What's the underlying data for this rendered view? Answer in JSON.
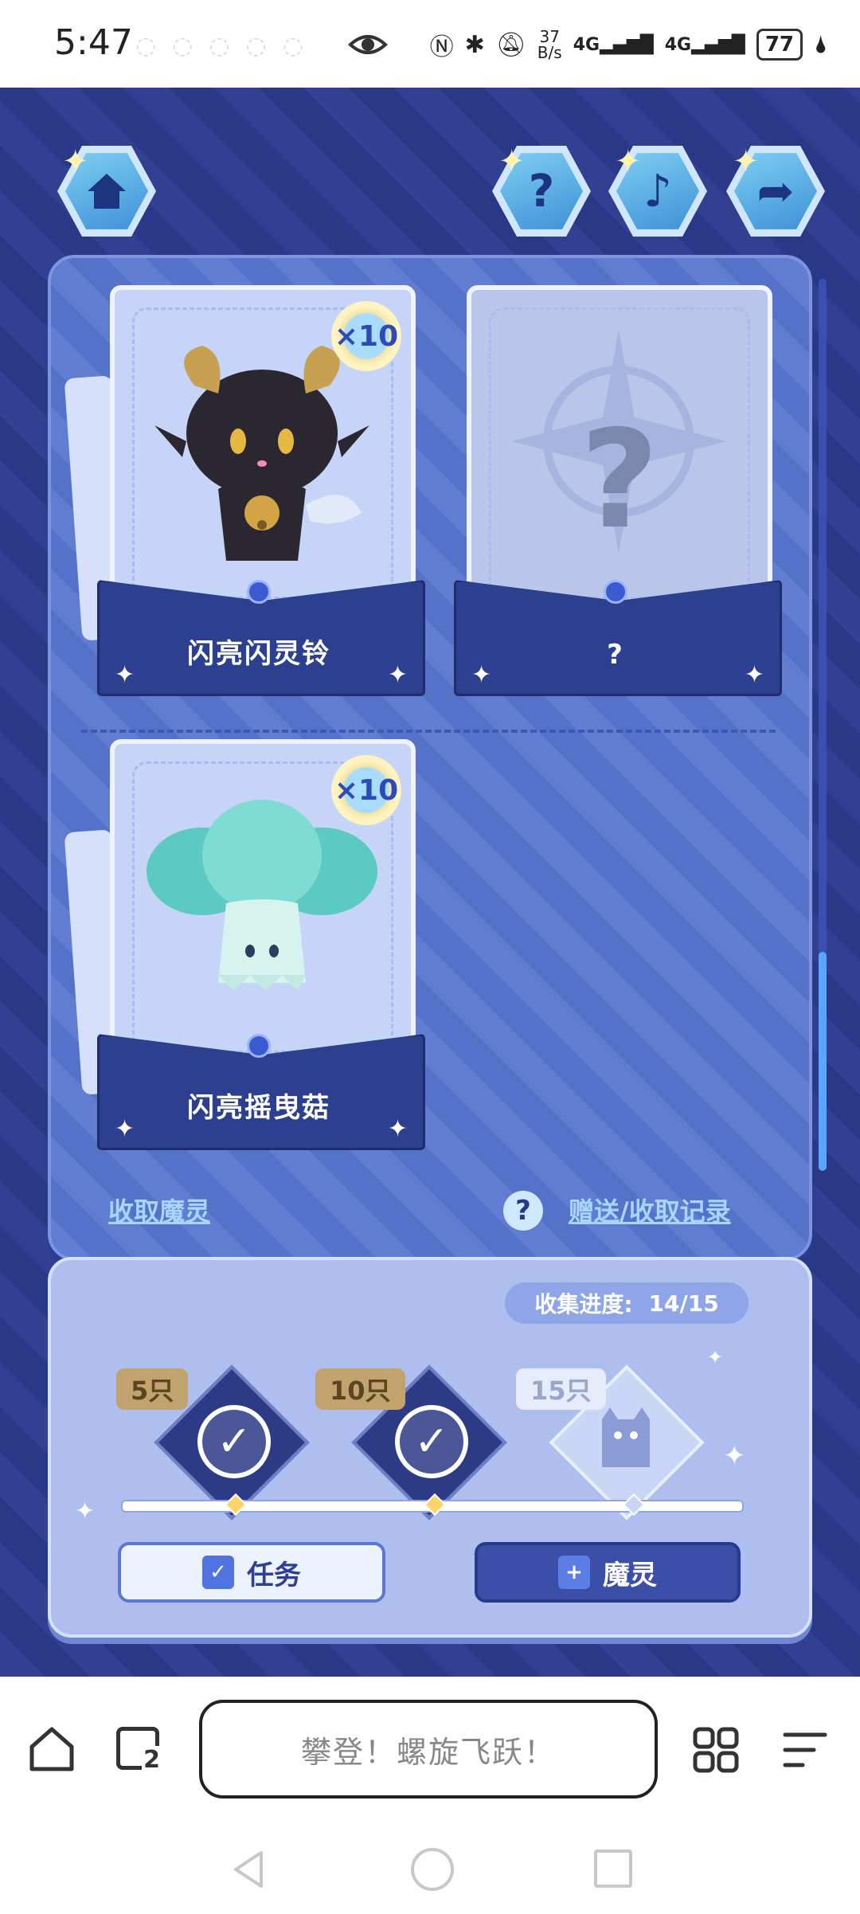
{
  "status_bar": {
    "time": "5:47",
    "net_speed_value": "37",
    "net_speed_unit": "B/s",
    "network_1": "4G",
    "network_2": "4G",
    "battery": "77"
  },
  "game": {
    "top_buttons": {
      "home": "home-icon",
      "help": "?",
      "music": "♪",
      "share": "➦"
    },
    "cards": [
      {
        "name": "闪亮闪灵铃",
        "count": "×10",
        "collected": true
      },
      {
        "name": "?",
        "count": "",
        "collected": false
      },
      {
        "name": "闪亮摇曳菇",
        "count": "×10",
        "collected": true
      }
    ],
    "links": {
      "claim": "收取魔灵",
      "help_symbol": "?",
      "history": "赠送/收取记录"
    },
    "progress": {
      "label": "收集进度:",
      "value": "14/15",
      "milestones": [
        {
          "tag": "5只",
          "done": true
        },
        {
          "tag": "10只",
          "done": true
        },
        {
          "tag": "15只",
          "done": false
        }
      ]
    },
    "buttons": {
      "task": "任务",
      "spirit": "魔灵"
    }
  },
  "browser": {
    "url_text": "攀登！螺旋飞跃！",
    "tab_count": "2"
  },
  "colors": {
    "game_bg": "#2c3a8e",
    "panel": "#5876cf",
    "progress_panel": "#aebfef",
    "accent_blue": "#5aa6ff"
  }
}
